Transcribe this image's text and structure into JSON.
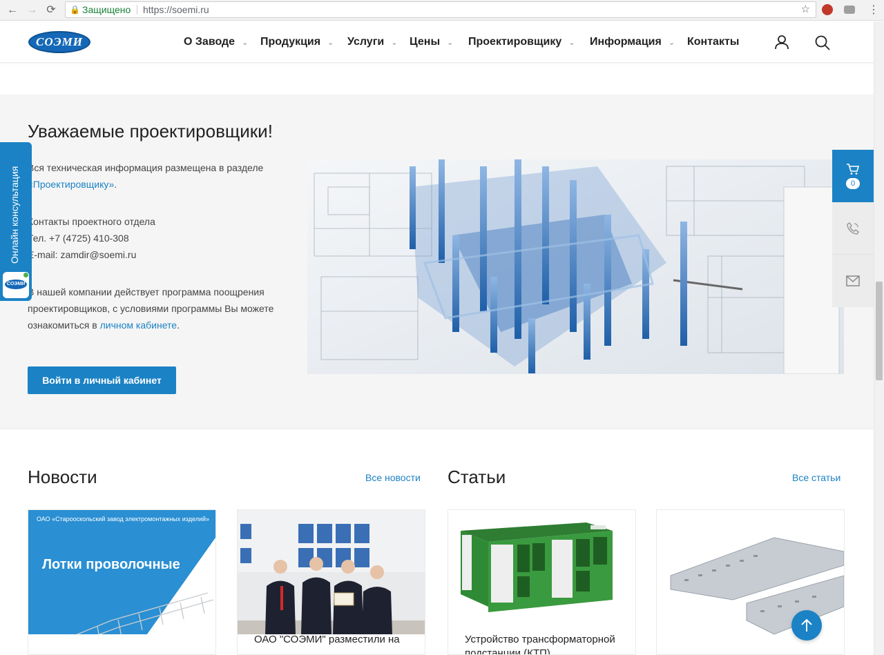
{
  "browser": {
    "secure_label": "Защищено",
    "url": "https://soemi.ru"
  },
  "header": {
    "logo_text": "СОЭМИ",
    "nav": [
      {
        "label": "О Заводе",
        "has_dropdown": true
      },
      {
        "label": "Продукция",
        "has_dropdown": true
      },
      {
        "label": "Услуги",
        "has_dropdown": true
      },
      {
        "label": "Цены",
        "has_dropdown": true
      },
      {
        "label": "Проектировщику",
        "has_dropdown": true
      },
      {
        "label": "Информация",
        "has_dropdown": true
      },
      {
        "label": "Контакты",
        "has_dropdown": false
      }
    ],
    "icons": [
      "user-icon",
      "search-icon"
    ]
  },
  "designers": {
    "title": "Уважаемые проектировщики!",
    "info_text": "Вся техническая информация размещена в разделе ",
    "info_link": "«Проектировщику»",
    "info_end": ".",
    "contacts_title": "Контакты проектного отдела",
    "phone": "Тел. +7 (4725) 410-308",
    "email": "E-mail: zamdir@soemi.ru",
    "program_text": "В нашей компании действует программа поощрения проектировщиков, с условиями программы Вы можете ознакомиться в ",
    "program_link": "личном кабинете",
    "program_end": ".",
    "button_label": "Войти в личный кабинет"
  },
  "consult": {
    "label": "Онлайн консультация",
    "logo_text": "СОЭМИ"
  },
  "side_panel": {
    "cart_count": "0"
  },
  "news": {
    "title": "Новости",
    "all_link": "Все новости",
    "items": [
      {
        "small_text": "ОАО «Старооскольский завод электромонтажных изделий»",
        "image_title": "Лотки проволочные",
        "caption": ""
      },
      {
        "caption": "ОАО \"СОЭМИ\" разместили на"
      }
    ]
  },
  "articles": {
    "title": "Статьи",
    "all_link": "Все статьи",
    "items": [
      {
        "caption": "Устройство трансформаторной подстанции (КТП)"
      },
      {
        "caption": ""
      }
    ]
  },
  "colors": {
    "accent": "#1b82c5",
    "link": "#1a82c4",
    "section_bg": "#f5f5f5"
  }
}
